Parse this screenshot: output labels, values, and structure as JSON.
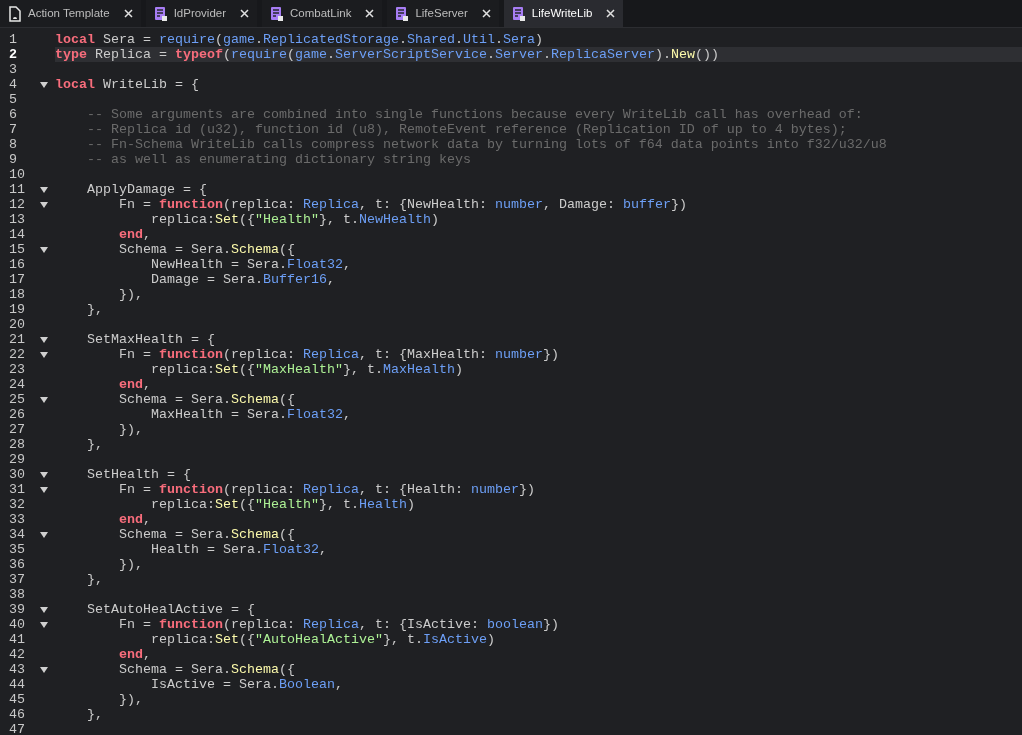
{
  "tabs": [
    {
      "label": "Action Template",
      "kind": "document",
      "selected": false
    },
    {
      "label": "IdProvider",
      "kind": "module",
      "selected": false
    },
    {
      "label": "CombatLink",
      "kind": "module",
      "selected": false
    },
    {
      "label": "LifeServer",
      "kind": "module",
      "selected": false
    },
    {
      "label": "LifeWriteLib",
      "kind": "module",
      "selected": true
    }
  ],
  "editor": {
    "lines": [
      {
        "number": "1",
        "fold": false,
        "highlighted": false,
        "tokens": [
          {
            "kind": "keyword",
            "text": "local"
          },
          {
            "kind": "plain",
            "text": " Sera = "
          },
          {
            "kind": "member",
            "text": "require"
          },
          {
            "kind": "plain",
            "text": "("
          },
          {
            "kind": "member",
            "text": "game"
          },
          {
            "kind": "plain",
            "text": "."
          },
          {
            "kind": "member",
            "text": "ReplicatedStorage"
          },
          {
            "kind": "plain",
            "text": "."
          },
          {
            "kind": "member",
            "text": "Shared"
          },
          {
            "kind": "plain",
            "text": "."
          },
          {
            "kind": "member",
            "text": "Util"
          },
          {
            "kind": "plain",
            "text": "."
          },
          {
            "kind": "member",
            "text": "Sera"
          },
          {
            "kind": "plain",
            "text": ")"
          }
        ]
      },
      {
        "number": "2",
        "fold": false,
        "highlighted": true,
        "tokens": [
          {
            "kind": "keyword",
            "text": "type"
          },
          {
            "kind": "plain",
            "text": " Replica = "
          },
          {
            "kind": "keyword",
            "text": "typeof"
          },
          {
            "kind": "plain",
            "text": "("
          },
          {
            "kind": "member",
            "text": "require"
          },
          {
            "kind": "plain",
            "text": "("
          },
          {
            "kind": "member",
            "text": "game"
          },
          {
            "kind": "plain",
            "text": "."
          },
          {
            "kind": "member",
            "text": "ServerScriptService"
          },
          {
            "kind": "plain",
            "text": "."
          },
          {
            "kind": "member",
            "text": "Server"
          },
          {
            "kind": "plain",
            "text": "."
          },
          {
            "kind": "member",
            "text": "ReplicaServer"
          },
          {
            "kind": "plain",
            "text": ")."
          },
          {
            "kind": "method",
            "text": "New"
          },
          {
            "kind": "plain",
            "text": "())"
          }
        ]
      },
      {
        "number": "3",
        "fold": false,
        "highlighted": false
      },
      {
        "number": "4",
        "fold": true,
        "highlighted": false,
        "tokens": [
          {
            "kind": "keyword",
            "text": "local"
          },
          {
            "kind": "plain",
            "text": " WriteLib = {"
          }
        ]
      },
      {
        "number": "5",
        "fold": false,
        "highlighted": false
      },
      {
        "number": "6",
        "fold": false,
        "highlighted": false,
        "tokens": [
          {
            "kind": "comment",
            "text": "    -- Some arguments are combined into single functions because every WriteLib call has overhead of:"
          }
        ]
      },
      {
        "number": "7",
        "fold": false,
        "highlighted": false,
        "tokens": [
          {
            "kind": "comment",
            "text": "    -- Replica id (u32), function id (u8), RemoteEvent reference (Replication ID of up to 4 bytes);"
          }
        ]
      },
      {
        "number": "8",
        "fold": false,
        "highlighted": false,
        "tokens": [
          {
            "kind": "comment",
            "text": "    -- Fn-Schema WriteLib calls compress network data by turning lots of f64 data points into f32/u32/u8"
          }
        ]
      },
      {
        "number": "9",
        "fold": false,
        "highlighted": false,
        "tokens": [
          {
            "kind": "comment",
            "text": "    -- as well as enumerating dictionary string keys"
          }
        ]
      },
      {
        "number": "10",
        "fold": false,
        "highlighted": false
      },
      {
        "number": "11",
        "fold": true,
        "highlighted": false,
        "tokens": [
          {
            "kind": "plain",
            "text": "    ApplyDamage = {"
          }
        ]
      },
      {
        "number": "12",
        "fold": true,
        "highlighted": false,
        "tokens": [
          {
            "kind": "plain",
            "text": "        Fn = "
          },
          {
            "kind": "keyword",
            "text": "function"
          },
          {
            "kind": "plain",
            "text": "(replica: "
          },
          {
            "kind": "member",
            "text": "Replica"
          },
          {
            "kind": "plain",
            "text": ", t: {NewHealth: "
          },
          {
            "kind": "member",
            "text": "number"
          },
          {
            "kind": "plain",
            "text": ", Damage: "
          },
          {
            "kind": "member",
            "text": "buffer"
          },
          {
            "kind": "plain",
            "text": "})"
          }
        ]
      },
      {
        "number": "13",
        "fold": false,
        "highlighted": false,
        "tokens": [
          {
            "kind": "plain",
            "text": "            replica:"
          },
          {
            "kind": "method",
            "text": "Set"
          },
          {
            "kind": "plain",
            "text": "({"
          },
          {
            "kind": "string",
            "text": "\"Health\""
          },
          {
            "kind": "plain",
            "text": "}, t."
          },
          {
            "kind": "member",
            "text": "NewHealth"
          },
          {
            "kind": "plain",
            "text": ")"
          }
        ]
      },
      {
        "number": "14",
        "fold": false,
        "highlighted": false,
        "tokens": [
          {
            "kind": "keyword",
            "text": "        end"
          },
          {
            "kind": "plain",
            "text": ","
          }
        ]
      },
      {
        "number": "15",
        "fold": true,
        "highlighted": false,
        "tokens": [
          {
            "kind": "plain",
            "text": "        Schema = Sera."
          },
          {
            "kind": "method",
            "text": "Schema"
          },
          {
            "kind": "plain",
            "text": "({"
          }
        ]
      },
      {
        "number": "16",
        "fold": false,
        "highlighted": false,
        "tokens": [
          {
            "kind": "plain",
            "text": "            NewHealth = Sera."
          },
          {
            "kind": "member",
            "text": "Float32"
          },
          {
            "kind": "plain",
            "text": ","
          }
        ]
      },
      {
        "number": "17",
        "fold": false,
        "highlighted": false,
        "tokens": [
          {
            "kind": "plain",
            "text": "            Damage = Sera."
          },
          {
            "kind": "member",
            "text": "Buffer16"
          },
          {
            "kind": "plain",
            "text": ","
          }
        ]
      },
      {
        "number": "18",
        "fold": false,
        "highlighted": false,
        "tokens": [
          {
            "kind": "plain",
            "text": "        }),"
          }
        ]
      },
      {
        "number": "19",
        "fold": false,
        "highlighted": false,
        "tokens": [
          {
            "kind": "plain",
            "text": "    },"
          }
        ]
      },
      {
        "number": "20",
        "fold": false,
        "highlighted": false
      },
      {
        "number": "21",
        "fold": true,
        "highlighted": false,
        "tokens": [
          {
            "kind": "plain",
            "text": "    SetMaxHealth = {"
          }
        ]
      },
      {
        "number": "22",
        "fold": true,
        "highlighted": false,
        "tokens": [
          {
            "kind": "plain",
            "text": "        Fn = "
          },
          {
            "kind": "keyword",
            "text": "function"
          },
          {
            "kind": "plain",
            "text": "(replica: "
          },
          {
            "kind": "member",
            "text": "Replica"
          },
          {
            "kind": "plain",
            "text": ", t: {MaxHealth: "
          },
          {
            "kind": "member",
            "text": "number"
          },
          {
            "kind": "plain",
            "text": "})"
          }
        ]
      },
      {
        "number": "23",
        "fold": false,
        "highlighted": false,
        "tokens": [
          {
            "kind": "plain",
            "text": "            replica:"
          },
          {
            "kind": "method",
            "text": "Set"
          },
          {
            "kind": "plain",
            "text": "({"
          },
          {
            "kind": "string",
            "text": "\"MaxHealth\""
          },
          {
            "kind": "plain",
            "text": "}, t."
          },
          {
            "kind": "member",
            "text": "MaxHealth"
          },
          {
            "kind": "plain",
            "text": ")"
          }
        ]
      },
      {
        "number": "24",
        "fold": false,
        "highlighted": false,
        "tokens": [
          {
            "kind": "keyword",
            "text": "        end"
          },
          {
            "kind": "plain",
            "text": ","
          }
        ]
      },
      {
        "number": "25",
        "fold": true,
        "highlighted": false,
        "tokens": [
          {
            "kind": "plain",
            "text": "        Schema = Sera."
          },
          {
            "kind": "method",
            "text": "Schema"
          },
          {
            "kind": "plain",
            "text": "({"
          }
        ]
      },
      {
        "number": "26",
        "fold": false,
        "highlighted": false,
        "tokens": [
          {
            "kind": "plain",
            "text": "            MaxHealth = Sera."
          },
          {
            "kind": "member",
            "text": "Float32"
          },
          {
            "kind": "plain",
            "text": ","
          }
        ]
      },
      {
        "number": "27",
        "fold": false,
        "highlighted": false,
        "tokens": [
          {
            "kind": "plain",
            "text": "        }),"
          }
        ]
      },
      {
        "number": "28",
        "fold": false,
        "highlighted": false,
        "tokens": [
          {
            "kind": "plain",
            "text": "    },"
          }
        ]
      },
      {
        "number": "29",
        "fold": false,
        "highlighted": false
      },
      {
        "number": "30",
        "fold": true,
        "highlighted": false,
        "tokens": [
          {
            "kind": "plain",
            "text": "    SetHealth = {"
          }
        ]
      },
      {
        "number": "31",
        "fold": true,
        "highlighted": false,
        "tokens": [
          {
            "kind": "plain",
            "text": "        Fn = "
          },
          {
            "kind": "keyword",
            "text": "function"
          },
          {
            "kind": "plain",
            "text": "(replica: "
          },
          {
            "kind": "member",
            "text": "Replica"
          },
          {
            "kind": "plain",
            "text": ", t: {Health: "
          },
          {
            "kind": "member",
            "text": "number"
          },
          {
            "kind": "plain",
            "text": "})"
          }
        ]
      },
      {
        "number": "32",
        "fold": false,
        "highlighted": false,
        "tokens": [
          {
            "kind": "plain",
            "text": "            replica:"
          },
          {
            "kind": "method",
            "text": "Set"
          },
          {
            "kind": "plain",
            "text": "({"
          },
          {
            "kind": "string",
            "text": "\"Health\""
          },
          {
            "kind": "plain",
            "text": "}, t."
          },
          {
            "kind": "member",
            "text": "Health"
          },
          {
            "kind": "plain",
            "text": ")"
          }
        ]
      },
      {
        "number": "33",
        "fold": false,
        "highlighted": false,
        "tokens": [
          {
            "kind": "keyword",
            "text": "        end"
          },
          {
            "kind": "plain",
            "text": ","
          }
        ]
      },
      {
        "number": "34",
        "fold": true,
        "highlighted": false,
        "tokens": [
          {
            "kind": "plain",
            "text": "        Schema = Sera."
          },
          {
            "kind": "method",
            "text": "Schema"
          },
          {
            "kind": "plain",
            "text": "({"
          }
        ]
      },
      {
        "number": "35",
        "fold": false,
        "highlighted": false,
        "tokens": [
          {
            "kind": "plain",
            "text": "            Health = Sera."
          },
          {
            "kind": "member",
            "text": "Float32"
          },
          {
            "kind": "plain",
            "text": ","
          }
        ]
      },
      {
        "number": "36",
        "fold": false,
        "highlighted": false,
        "tokens": [
          {
            "kind": "plain",
            "text": "        }),"
          }
        ]
      },
      {
        "number": "37",
        "fold": false,
        "highlighted": false,
        "tokens": [
          {
            "kind": "plain",
            "text": "    },"
          }
        ]
      },
      {
        "number": "38",
        "fold": false,
        "highlighted": false
      },
      {
        "number": "39",
        "fold": true,
        "highlighted": false,
        "tokens": [
          {
            "kind": "plain",
            "text": "    SetAutoHealActive = {"
          }
        ]
      },
      {
        "number": "40",
        "fold": true,
        "highlighted": false,
        "tokens": [
          {
            "kind": "plain",
            "text": "        Fn = "
          },
          {
            "kind": "keyword",
            "text": "function"
          },
          {
            "kind": "plain",
            "text": "(replica: "
          },
          {
            "kind": "member",
            "text": "Replica"
          },
          {
            "kind": "plain",
            "text": ", t: {IsActive: "
          },
          {
            "kind": "member",
            "text": "boolean"
          },
          {
            "kind": "plain",
            "text": "})"
          }
        ]
      },
      {
        "number": "41",
        "fold": false,
        "highlighted": false,
        "tokens": [
          {
            "kind": "plain",
            "text": "            replica:"
          },
          {
            "kind": "method",
            "text": "Set"
          },
          {
            "kind": "plain",
            "text": "({"
          },
          {
            "kind": "string",
            "text": "\"AutoHealActive\""
          },
          {
            "kind": "plain",
            "text": "}, t."
          },
          {
            "kind": "member",
            "text": "IsActive"
          },
          {
            "kind": "plain",
            "text": ")"
          }
        ]
      },
      {
        "number": "42",
        "fold": false,
        "highlighted": false,
        "tokens": [
          {
            "kind": "keyword",
            "text": "        end"
          },
          {
            "kind": "plain",
            "text": ","
          }
        ]
      },
      {
        "number": "43",
        "fold": true,
        "highlighted": false,
        "tokens": [
          {
            "kind": "plain",
            "text": "        Schema = Sera."
          },
          {
            "kind": "method",
            "text": "Schema"
          },
          {
            "kind": "plain",
            "text": "({"
          }
        ]
      },
      {
        "number": "44",
        "fold": false,
        "highlighted": false,
        "tokens": [
          {
            "kind": "plain",
            "text": "            IsActive = Sera."
          },
          {
            "kind": "member",
            "text": "Boolean"
          },
          {
            "kind": "plain",
            "text": ","
          }
        ]
      },
      {
        "number": "45",
        "fold": false,
        "highlighted": false,
        "tokens": [
          {
            "kind": "plain",
            "text": "        }),"
          }
        ]
      },
      {
        "number": "46",
        "fold": false,
        "highlighted": false,
        "tokens": [
          {
            "kind": "plain",
            "text": "    },"
          }
        ]
      },
      {
        "number": "47",
        "fold": false,
        "highlighted": false
      }
    ]
  }
}
